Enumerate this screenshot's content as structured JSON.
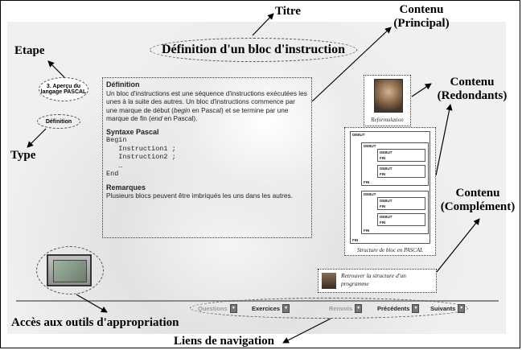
{
  "annotations": {
    "titre": "Titre",
    "contenu_principal_1": "Contenu",
    "contenu_principal_2": "(Principal)",
    "contenu_redondants_1": "Contenu",
    "contenu_redondants_2": "(Redondants)",
    "contenu_complement_1": "Contenu",
    "contenu_complement_2": "(Complément)",
    "etape": "Etape",
    "type": "Type",
    "outils": "Accès aux outils d'appropriation",
    "liens": "Liens de navigation"
  },
  "page": {
    "title": "Définition d'un bloc d'instruction",
    "step": "3. Aperçu du langage PASCAL",
    "type": "Définition"
  },
  "content": {
    "def_heading": "Définition",
    "def_text_1": "Un bloc d'instructions est une séquence d'instructions exécutées les unes à la suite des autres. Un bloc d'instructions commence par une marque de début (",
    "def_begin": "begin",
    "def_text_2": " en Pascal) et se termine par une marque de fin (",
    "def_end": "end",
    "def_text_3": " en Pascal).",
    "syntax_heading": "Syntaxe Pascal",
    "code_begin": "Begin",
    "code_line1": "   Instruction1 ;",
    "code_line2": "   Instruction2 ;",
    "code_dots": "   …",
    "code_end": "End",
    "remarks_heading": "Remarques",
    "remarks_text": "Plusieurs blocs peuvent être imbriqués les uns dans les autres."
  },
  "sidebar": {
    "portrait_caption": "Reformulation",
    "structure_caption": "Structure de bloc en PASCAL",
    "retro_text": "Retrouver la structure d'un programme",
    "debut": "DEBUT",
    "fin": "FIN"
  },
  "nav": {
    "questions": "Questions",
    "exercices": "Exercices",
    "renvois": "Renvois",
    "precedents": "Précédents",
    "suivants": "Suivants"
  }
}
